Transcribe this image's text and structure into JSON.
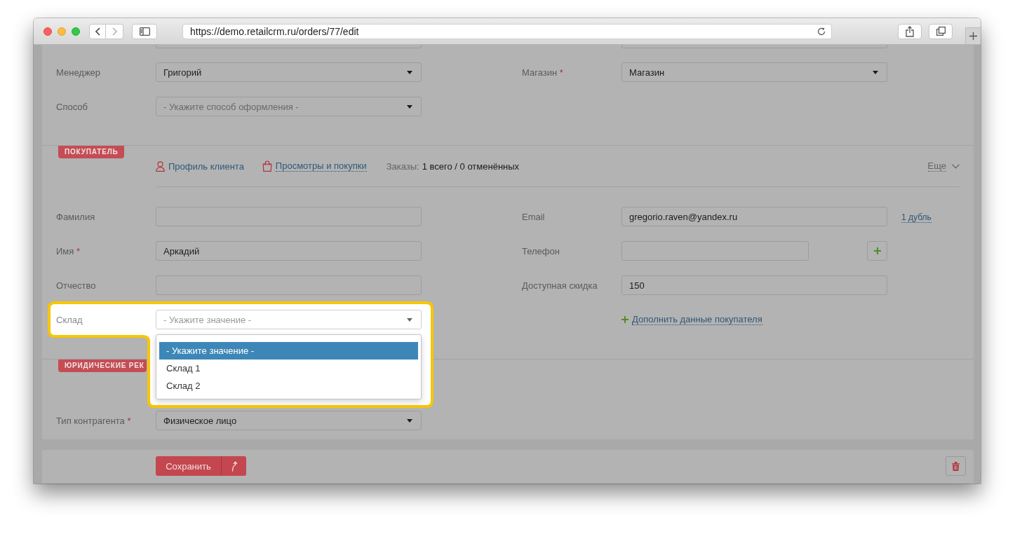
{
  "browser": {
    "nav": [
      {
        "kind": "back",
        "disabled": false
      },
      {
        "kind": "forward",
        "disabled": true
      }
    ],
    "url": "https://demo.retailcrm.ru/orders/77/edit"
  },
  "main": {
    "cut_off_row": {
      "left": {
        "kind": "input"
      },
      "right": {
        "kind": "input"
      }
    },
    "rows": [
      {
        "left": {
          "kind": "select",
          "label": "Менеджер",
          "value": "Григорий"
        },
        "right": {
          "kind": "select",
          "label": "Магазин",
          "required_mark": "*",
          "value": "Магазин"
        }
      },
      {
        "left": {
          "kind": "select",
          "label": "Способ",
          "placeholder": "- Укажите способ оформления -"
        }
      }
    ]
  },
  "buyer": {
    "badge": "ПОКУПАТЕЛЬ",
    "links": [
      {
        "kind": "profile",
        "text": "Профиль клиента"
      },
      {
        "kind": "views",
        "text": "Просмотры и покупки"
      }
    ],
    "orders_label": "Заказы:",
    "orders_value": "1 всего / 0 отменённых",
    "more": "Еще",
    "rows": [
      {
        "left": {
          "kind": "input",
          "label": "Фамилия"
        },
        "right": {
          "kind": "input",
          "label": "Email",
          "value": "gregorio.raven@yandex.ru"
        },
        "extra": {
          "kind": "link",
          "text": "1 дубль"
        }
      },
      {
        "left": {
          "kind": "input",
          "label": "Имя",
          "required_mark": "*",
          "value": "Аркадий"
        },
        "right": {
          "kind": "input_with_add",
          "label": "Телефон"
        }
      },
      {
        "left": {
          "kind": "input",
          "label": "Отчество"
        },
        "right": {
          "kind": "input",
          "label": "Доступная скидка",
          "value": "150"
        }
      },
      {
        "left": {
          "kind": "select",
          "label": "Склад",
          "placeholder": "- Укажите значение -",
          "highlighted": true,
          "expanded": true,
          "options": [
            {
              "text": "- Укажите значение -",
              "selected": true
            },
            {
              "text": "Склад 1",
              "selected": false
            },
            {
              "text": "Склад 2",
              "selected": false
            }
          ]
        },
        "right": {
          "kind": "add_link",
          "text": "Дополнить данные покупателя"
        }
      }
    ]
  },
  "legal": {
    "badge": "ЮРИДИЧЕСКИЕ РЕК",
    "rows": [
      {
        "left": {
          "kind": "select",
          "label": "Тип контрагента",
          "required_mark": "*",
          "value": "Физическое лицо"
        }
      }
    ]
  },
  "footer": {
    "save": "Сохранить"
  }
}
